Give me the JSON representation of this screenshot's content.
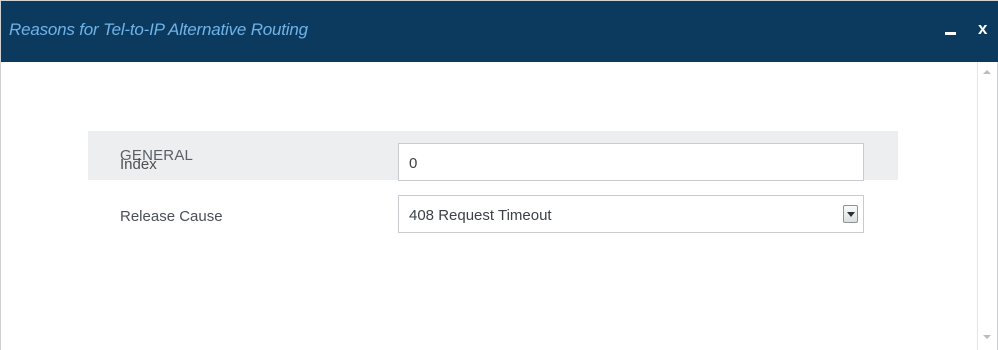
{
  "dialog": {
    "title": "Reasons for Tel-to-IP Alternative Routing",
    "minimize_icon": "minimize-icon",
    "close_label": "x",
    "colors": {
      "titlebar": "#0c3a5e",
      "title_text": "#6fb3e8",
      "section_bg": "#eceeef"
    }
  },
  "section": {
    "title": "GENERAL"
  },
  "fields": {
    "index": {
      "label": "Index",
      "value": "0"
    },
    "release_cause": {
      "label": "Release Cause",
      "value": "408 Request Timeout",
      "icon": "chevron-down-icon"
    }
  },
  "scrollbar": {
    "up_icon": "scroll-up-icon",
    "down_icon": "scroll-down-icon"
  }
}
